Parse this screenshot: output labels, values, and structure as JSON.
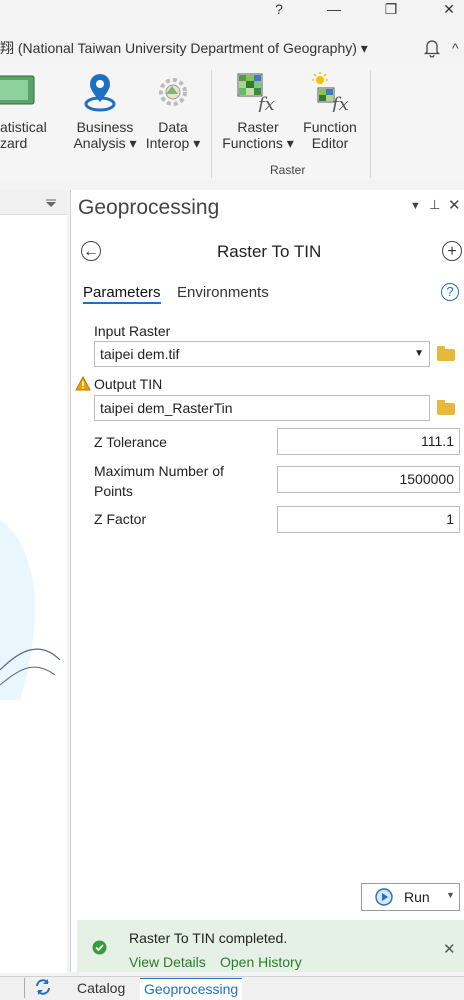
{
  "window": {
    "help_glyph": "?",
    "min_glyph": "—",
    "restore_glyph": "❐",
    "close_glyph": "✕"
  },
  "account": {
    "text": "翔 (National Taiwan University Department of Geography) ▾"
  },
  "ribbon": {
    "statistical_wizard": [
      "atistical",
      "zard"
    ],
    "business_analysis": [
      "Business",
      "Analysis ▾"
    ],
    "data_interop": [
      "Data",
      "Interop ▾"
    ],
    "raster_functions": [
      "Raster",
      "Functions ▾"
    ],
    "function_editor": [
      "Function",
      "Editor"
    ],
    "group_raster": "Raster"
  },
  "gp": {
    "title": "Geoprocessing",
    "tool_title": "Raster To TIN",
    "tab_parameters": "Parameters",
    "tab_environments": "Environments",
    "input_raster_label": "Input Raster",
    "input_raster_value": "taipei dem.tif",
    "output_tin_label": "Output TIN",
    "output_tin_value": "taipei dem_RasterTin",
    "z_tolerance_label": "Z Tolerance",
    "z_tolerance_value": "111.1",
    "max_points_label_1": "Maximum Number of",
    "max_points_label_2": "Points",
    "max_points_value": "1500000",
    "z_factor_label": "Z Factor",
    "z_factor_value": "1",
    "run_label": "Run"
  },
  "status": {
    "message": "Raster To TIN completed.",
    "view_details": "View Details",
    "open_history": "Open History"
  },
  "bottom_tabs": {
    "catalog": "Catalog",
    "geoprocessing": "Geoprocessing"
  },
  "colors": {
    "accent_blue": "#1f6fc5",
    "success_green": "#2c7a2c",
    "warning_orange": "#e8a000"
  }
}
